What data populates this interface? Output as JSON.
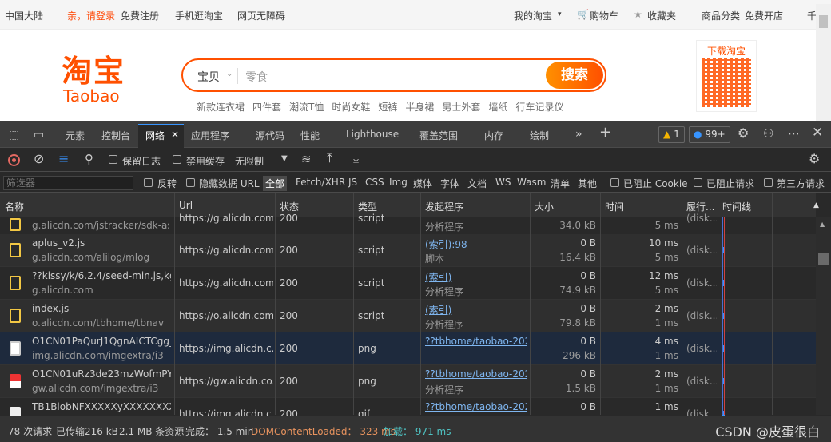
{
  "taobao": {
    "topbar": {
      "region": "中国大陆",
      "login": "亲，请登录",
      "register": "免费注册",
      "mobile": "手机逛淘宝",
      "accessible": "网页无障碍",
      "my_taobao": "我的淘宝",
      "cart": "购物车",
      "favorites": "收藏夹",
      "categories": "商品分类",
      "open_shop": "免费开店",
      "more": "千"
    },
    "logo_cn": "淘宝",
    "logo_en": "Taobao",
    "search": {
      "category": "宝贝",
      "placeholder": "零食",
      "button": "搜索"
    },
    "hot": [
      "新款连衣裙",
      "四件套",
      "潮流T恤",
      "时尚女鞋",
      "短裤",
      "半身裙",
      "男士外套",
      "墙纸",
      "行车记录仪"
    ],
    "qr_label": "下载淘宝"
  },
  "devtools": {
    "tabs": {
      "elements": "元素",
      "console": "控制台",
      "network": "网络",
      "application": "应用程序",
      "sources": "源代码",
      "performance": "性能",
      "lighthouse": "Lighthouse",
      "coverage": "覆盖范围",
      "memory": "内存",
      "rendering": "绘制"
    },
    "warnings": "1",
    "issues": "99+",
    "toolbar": {
      "preserve_log": "保留日志",
      "disable_cache": "禁用缓存",
      "throttle": "无限制"
    },
    "filter": {
      "placeholder": "筛选器",
      "invert": "反转",
      "hide_data": "隐藏数据 URL",
      "all": "全部",
      "fetch": "Fetch/XHR",
      "js": "JS",
      "css": "CSS",
      "img": "Img",
      "media": "媒体",
      "font": "字体",
      "doc": "文档",
      "ws": "WS",
      "wasm": "Wasm",
      "manifest": "清单",
      "other": "其他",
      "blocked_cookies": "已阻止 Cookie",
      "blocked_requests": "已阻止请求",
      "third_party": "第三方请求"
    },
    "columns": {
      "name": "名称",
      "url": "Url",
      "status": "状态",
      "type": "类型",
      "initiator": "发起程序",
      "size": "大小",
      "time": "时间",
      "fulfilled": "履行...",
      "waterfall": "时间线"
    },
    "rows": [
      {
        "name": "",
        "domain": "g.alicdn.com/jstracker/sdk-ass...",
        "url": "https://g.alicdn.com...",
        "status": "200",
        "type": "script",
        "initiator": "",
        "initiator_sub": "分析程序",
        "size": "",
        "size_sub": "34.0 kB",
        "time": "",
        "time_sub": "5 ms",
        "fulfilled": "(disk..."
      },
      {
        "name": "aplus_v2.js",
        "domain": "g.alicdn.com/alilog/mlog",
        "url": "https://g.alicdn.com...",
        "status": "200",
        "type": "script",
        "initiator": "(索引):98",
        "initiator_sub": "脚本",
        "size": "0 B",
        "size_sub": "16.4 kB",
        "time": "10 ms",
        "time_sub": "5 ms",
        "fulfilled": "(disk..."
      },
      {
        "name": "??kissy/k/6.2.4/seed-min.js,kg/...",
        "domain": "g.alicdn.com",
        "url": "https://g.alicdn.com...",
        "status": "200",
        "type": "script",
        "initiator": "(索引)",
        "initiator_sub": "分析程序",
        "size": "0 B",
        "size_sub": "74.9 kB",
        "time": "12 ms",
        "time_sub": "5 ms",
        "fulfilled": "(disk..."
      },
      {
        "name": "index.js",
        "domain": "o.alicdn.com/tbhome/tbnav",
        "url": "https://o.alicdn.com...",
        "status": "200",
        "type": "script",
        "initiator": "(索引)",
        "initiator_sub": "分析程序",
        "size": "0 B",
        "size_sub": "79.8 kB",
        "time": "2 ms",
        "time_sub": "1 ms",
        "fulfilled": "(disk..."
      },
      {
        "name": "O1CN01PaQurJ1QgnAICTCgg_!...",
        "domain": "img.alicdn.com/imgextra/i3",
        "url": "https://img.alicdn.c...",
        "status": "200",
        "type": "png",
        "initiator": "??tbhome/taobao-202...",
        "initiator_sub": "",
        "size": "0 B",
        "size_sub": "296 kB",
        "time": "4 ms",
        "time_sub": "1 ms",
        "fulfilled": "(disk..."
      },
      {
        "name": "O1CN01uRz3de23mzWofmPYX...",
        "domain": "gw.alicdn.com/imgextra/i3",
        "url": "https://gw.alicdn.co...",
        "status": "200",
        "type": "png",
        "initiator": "??tbhome/taobao-202...",
        "initiator_sub": "分析程序",
        "size": "0 B",
        "size_sub": "1.5 kB",
        "time": "2 ms",
        "time_sub": "1 ms",
        "fulfilled": "(disk..."
      },
      {
        "name": "TB1BlobNFXXXXXyXXXXXXXXX...",
        "domain": "",
        "url": "https://img.alicdn.c...",
        "status": "200",
        "type": "gif",
        "initiator": "??tbhome/taobao-202...",
        "initiator_sub": "",
        "size": "0 B",
        "size_sub": "",
        "time": "1 ms",
        "time_sub": "",
        "fulfilled": "(disk..."
      }
    ],
    "status": {
      "requests": "78 次请求",
      "transferred": "已传输216 kB",
      "resources": "2.1 MB 条资源",
      "finish": "完成： 1.5 min",
      "dcl": "DOMContentLoaded： 323 ms",
      "load": "加载： 971 ms"
    }
  },
  "watermark": "CSDN @皮蛋很白"
}
